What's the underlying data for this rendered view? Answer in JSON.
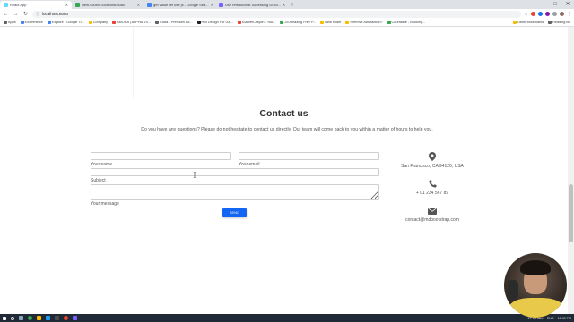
{
  "browser": {
    "tabs": [
      {
        "title": "React App",
        "color": "#61dafb",
        "active": true
      },
      {
        "title": "view-source:localhost:8080",
        "color": "#34a853",
        "active": false
      },
      {
        "title": "get value ref use js - Google Sea...",
        "color": "#4285f4",
        "active": false
      },
      {
        "title": "Use refs tutorial: Accessing DOM...",
        "color": "#7b61ff",
        "active": false
      }
    ],
    "new_tab": "+",
    "address": "localhost:8080",
    "bookmarks": [
      {
        "label": "Apps",
        "color": "#5f6368"
      },
      {
        "label": "Ecommerce",
        "color": "#4285f4"
      },
      {
        "label": "Explore - Google Tr...",
        "color": "#4285f4"
      },
      {
        "label": "Company",
        "color": "#fbbc04"
      },
      {
        "label": "AMORA | ALPHA VS...",
        "color": "#ea4335"
      },
      {
        "label": "Cuba - Premium Ad...",
        "color": "#5f6368"
      },
      {
        "label": "HBI Design For Ga...",
        "color": "#202124"
      },
      {
        "label": "iGamerCrayon - You...",
        "color": "#ea4335"
      },
      {
        "label": "25 Amazing Free P...",
        "color": "#34a853"
      },
      {
        "label": "New folder",
        "color": "#fbbc04"
      },
      {
        "label": "Remove Abstraction?",
        "color": "#fbbc04"
      },
      {
        "label": "Countable - Booking...",
        "color": "#34a853"
      }
    ],
    "bookmarks_right": [
      "Other bookmarks",
      "Reading list"
    ]
  },
  "contact": {
    "title": "Contact us",
    "description": "Do you have any questions? Please do not hesitate to contact us directly. Our team will come back to you within a matter of hours to help you.",
    "form": {
      "name_label": "Your name",
      "email_label": "Your email",
      "subject_label": "Subject",
      "message_label": "Your message",
      "name_value": "",
      "email_value": "",
      "subject_value": "",
      "message_value": "",
      "send_label": "SEND"
    },
    "info": {
      "address": "San Francisco, CA 94126, USA",
      "phone": "+ 01 234 567 89",
      "email": "contact@mdbootstrap.com"
    }
  },
  "taskbar": {
    "weather": "17°C  Haze",
    "language": "ENG",
    "time": "10:40 PM",
    "date": "8/15/2021"
  }
}
